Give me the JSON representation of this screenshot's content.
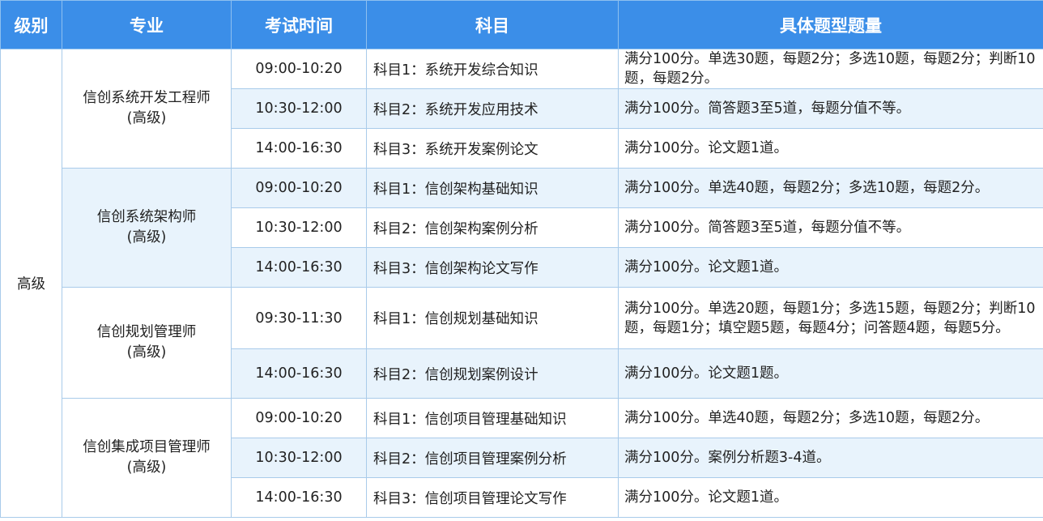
{
  "headers": {
    "level": "级别",
    "major": "专业",
    "time": "考试时间",
    "subject": "科目",
    "detail": "具体题型题量"
  },
  "level": "高级",
  "majors": [
    {
      "name_line1": "信创系统开发工程师",
      "name_line2": "(高级)",
      "rows": [
        {
          "time": "09:00-10:20",
          "subject": "科目1：系统开发综合知识",
          "detail": "满分100分。单选30题，每题2分；多选10题，每题2分；判断10题，每题2分。"
        },
        {
          "time": "10:30-12:00",
          "subject": "科目2：系统开发应用技术",
          "detail": "满分100分。简答题3至5道，每题分值不等。"
        },
        {
          "time": "14:00-16:30",
          "subject": "科目3：系统开发案例论文",
          "detail": "满分100分。论文题1道。"
        }
      ]
    },
    {
      "name_line1": "信创系统架构师",
      "name_line2": "(高级)",
      "rows": [
        {
          "time": "09:00-10:20",
          "subject": "科目1：信创架构基础知识",
          "detail": "满分100分。单选40题，每题2分；多选10题，每题2分。"
        },
        {
          "time": "10:30-12:00",
          "subject": "科目2：信创架构案例分析",
          "detail": "满分100分。简答题3至5道，每题分值不等。"
        },
        {
          "time": "14:00-16:30",
          "subject": "科目3：信创架构论文写作",
          "detail": "满分100分。论文题1道。"
        }
      ]
    },
    {
      "name_line1": "信创规划管理师",
      "name_line2": "(高级)",
      "rows": [
        {
          "time": "09:30-11:30",
          "subject": "科目1：信创规划基础知识",
          "detail": "满分100分。单选20题，每题1分；多选15题，每题2分；判断10题，每题1分；填空题5题，每题4分；问答题4题，每题5分。"
        },
        {
          "time": "14:00-16:30",
          "subject": "科目2：信创规划案例设计",
          "detail": "满分100分。论文题1题。"
        }
      ]
    },
    {
      "name_line1": "信创集成项目管理师",
      "name_line2": "(高级)",
      "rows": [
        {
          "time": "09:00-10:20",
          "subject": "科目1：信创项目管理基础知识",
          "detail": "满分100分。单选40题，每题2分；多选10题，每题2分。"
        },
        {
          "time": "10:30-12:00",
          "subject": "科目2：信创项目管理案例分析",
          "detail": "满分100分。案例分析题3-4道。"
        },
        {
          "time": "14:00-16:30",
          "subject": "科目3：信创项目管理论文写作",
          "detail": "满分100分。论文题1道。"
        }
      ]
    }
  ]
}
